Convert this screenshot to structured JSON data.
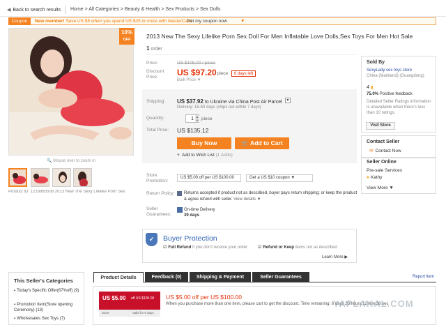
{
  "nav": {
    "back": "Back to search results",
    "breadcrumb": "Home > All Categories > Beauty & Health > Sex Products > Sex Dolls"
  },
  "coupon_bar": {
    "tag": "Coupon",
    "text_bold": "New member!",
    "text": "Save US $5 when you spend US $25 or more with MasterCard",
    "link": "Get my coupon now",
    "arrow": "▼"
  },
  "gallery": {
    "discount_pct": "10%",
    "discount_off": "OFF",
    "zoom_hint": "Mouse over to zoom in",
    "product_id": "Product ID: 1216880508 2013 New The Sexy Lifelike Porn Sex"
  },
  "product": {
    "title": "2013 New The Sexy Lifelike Porn Sex Doll For Men Inflatable Love Dolls,Sex Toys For Men Hot Sale",
    "order_count": "1",
    "order_label": "order",
    "price_label": "Price:",
    "price_old": "US $108.00 / piece",
    "discount_label": "Discount Price:",
    "price_new": "US $97.20",
    "per_piece": "/ piece",
    "days_left": "6 days left",
    "bulk_price": "Bulk Price ▼",
    "shipping_label": "Shipping:",
    "shipping_price": "US $37.92",
    "shipping_to": "to Ukraine via China Post Air Parcel",
    "delivery": "Delivery: 15-60 days (ships out within 7 days)",
    "quantity_label": "Quantity:",
    "quantity_value": "1",
    "quantity_unit": "piece",
    "total_label": "Total Price:",
    "total_price": "US $135.12",
    "buy_now": "Buy Now",
    "add_to_cart": "Add to Cart",
    "wish_list": "Add to Wish List",
    "wish_count": "(1 Adds)",
    "store_promo_label": "Store Promotion:",
    "promo_1": "US $5.00 off per US $100.00",
    "promo_2": "Get a US $10 coupon ▼",
    "return_label": "Return Policy:",
    "return_text": "Returns accepted if product not as described, buyer pays return shipping; or keep the product & agree refund with seller.",
    "return_link": "View details ▼",
    "guarantee_label": "Seller Guarantees:",
    "guarantee_title": "On-time Delivery",
    "guarantee_days": "39 days"
  },
  "seller": {
    "sold_by": "Sold By",
    "name": "SexyLady sex toys store",
    "location": "China (Mainland) (Guangdong)",
    "level": "4",
    "feedback_pct": "75.0%",
    "feedback_label": "Positive feedback",
    "rating_note": "Detailed Seller Ratings information is unavailable when there's less than 10 ratings.",
    "visit_store": "Visit Store",
    "contact_heading": "Contact Seller",
    "contact_now": "Contact Now",
    "online_heading": "Seller Online",
    "presale": "Pre-sale Services",
    "agent": "Kathy",
    "view_more": "View More ▼"
  },
  "protection": {
    "title": "Buyer Protection",
    "full_refund_bold": "Full Refund",
    "full_refund_text": "if you don't receive your order",
    "return_bold": "Refund or Keep",
    "return_text": "items not as described",
    "learn_more": "Learn More ▶"
  },
  "categories": {
    "heading": "This Seller's Categories",
    "items": [
      "Today's Specific Offer(67%off) (9)",
      "Promotion Item(Store opening Ceremony) (13)",
      "Wholsesales Sex Toys (7)"
    ]
  },
  "tabs": {
    "items": [
      "Product Details",
      "Feedback (0)",
      "Shipping & Payment",
      "Seller Guarantees"
    ],
    "report": "Report item"
  },
  "details": {
    "coupon_amount": "US $5.00",
    "coupon_off": "off US $100.00",
    "coupon_store": "Store",
    "coupon_valid": "Valid for 5 days",
    "title": "US $5.00 off per US $100.00",
    "desc": "When you purchase more than one item, please cart to get the discount. Time remaining: 6 days 20 hours 12 min 38 sec"
  },
  "watermark": "YAPLAKAL.COM",
  "colors": {
    "accent": "#f58220",
    "price": "#e62e04",
    "protection": "#2e63b0",
    "coupon_card": "#c9102b"
  }
}
